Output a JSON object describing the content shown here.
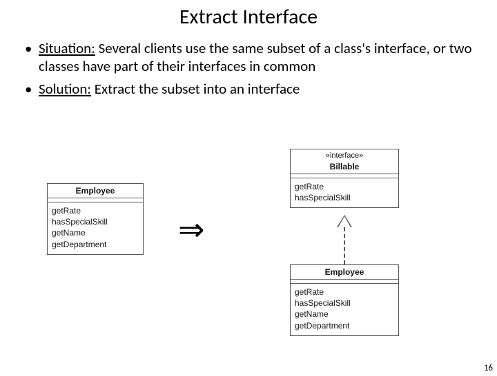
{
  "title": "Extract Interface",
  "bullets": {
    "b1": {
      "label": "Situation:",
      "text": " Several clients use the same subset of a class's interface, or two classes have part of their interfaces in common"
    },
    "b2": {
      "label": "Solution:",
      "text": " Extract the subset into an interface"
    }
  },
  "left": {
    "name": "Employee",
    "ops": [
      "getRate",
      "hasSpecialSkill",
      "getName",
      "getDepartment"
    ]
  },
  "iface": {
    "stereo": "«interface»",
    "name": "Billable",
    "ops": [
      "getRate",
      "hasSpecialSkill"
    ]
  },
  "right": {
    "name": "Employee",
    "ops": [
      "getRate",
      "hasSpecialSkill",
      "getName",
      "getDepartment"
    ]
  },
  "arrow": "⇒",
  "page": "16"
}
